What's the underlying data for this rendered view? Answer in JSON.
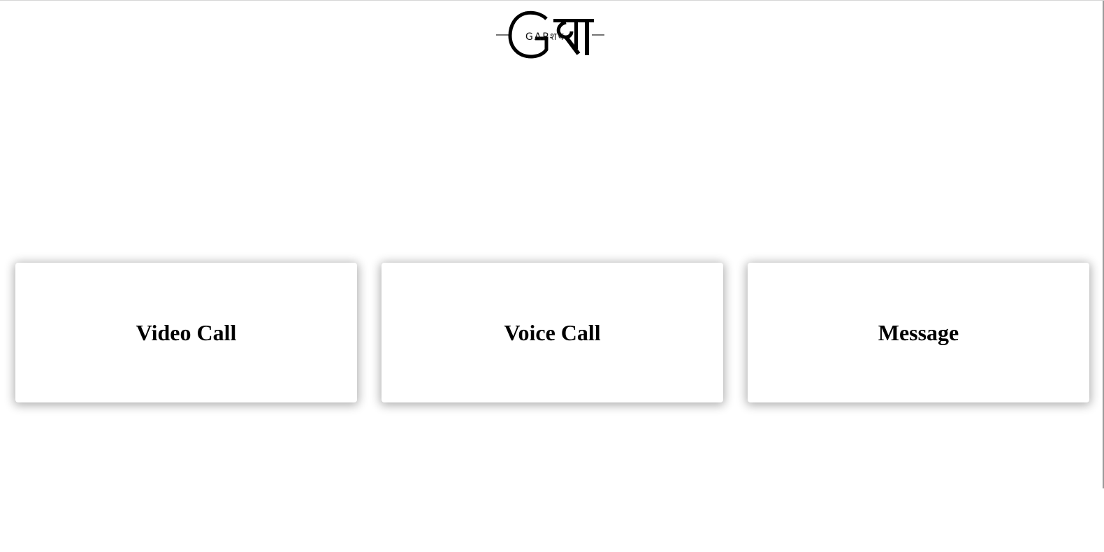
{
  "logo": {
    "brand_text": "GAPशप"
  },
  "cards": [
    {
      "label": "Video Call"
    },
    {
      "label": "Voice Call"
    },
    {
      "label": "Message"
    }
  ]
}
